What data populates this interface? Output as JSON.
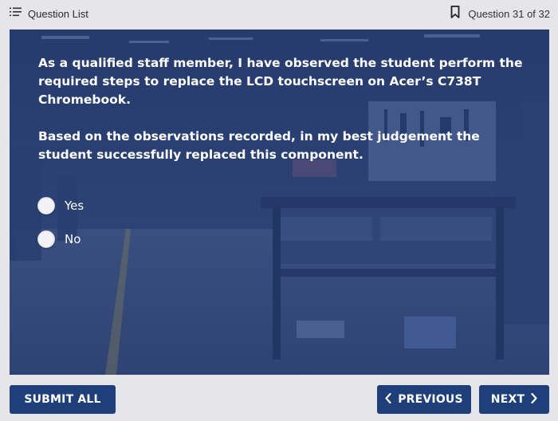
{
  "header": {
    "question_list_label": "Question List",
    "question_counter": "Question 31 of 32",
    "icons": {
      "list": "list-icon",
      "bookmark": "bookmark-icon"
    }
  },
  "question": {
    "paragraphs": [
      "As a qualified staff member, I have observed the student perform the required steps to replace the LCD touchscreen on Acer’s C738T Chromebook.",
      "Based on the observations recorded, in my best judgement the student successfully replaced this component."
    ],
    "options": [
      {
        "label": "Yes",
        "selected": false
      },
      {
        "label": "No",
        "selected": false
      }
    ]
  },
  "footer": {
    "submit_label": "SUBMIT ALL",
    "previous_label": "PREVIOUS",
    "next_label": "NEXT"
  },
  "colors": {
    "page_bg": "#e6e6ea",
    "button_bg": "#1e3f7a",
    "overlay": "#203876",
    "text_light": "#ffffff"
  }
}
